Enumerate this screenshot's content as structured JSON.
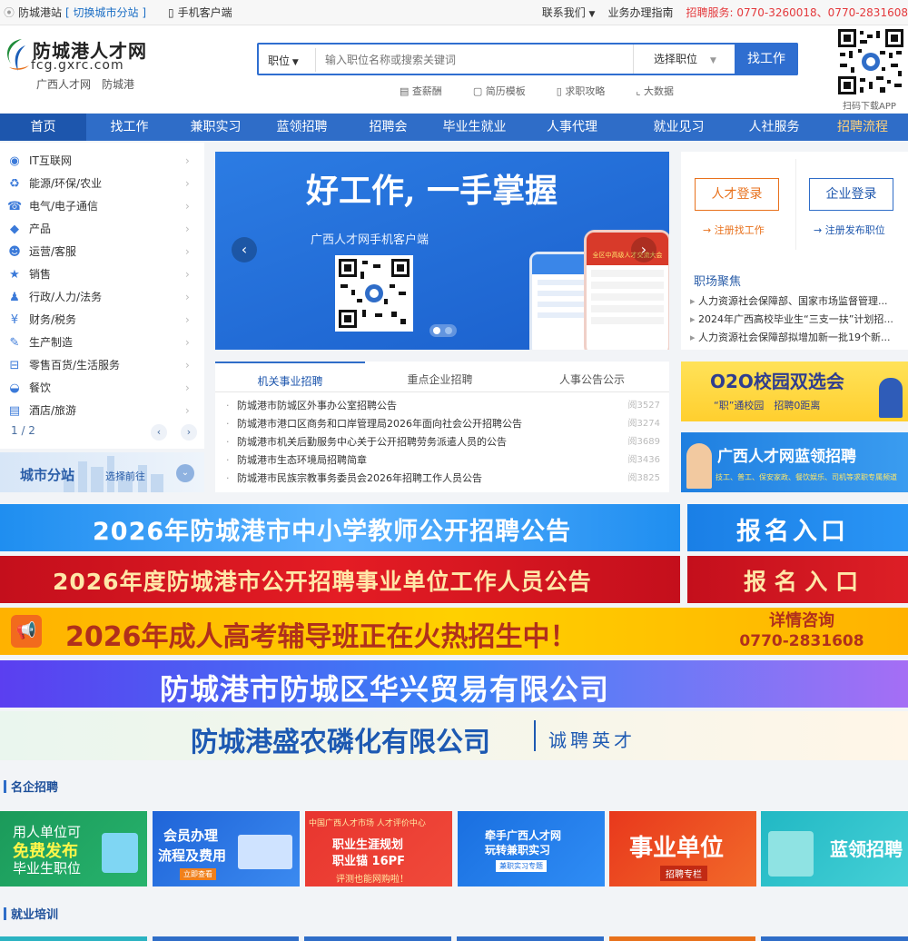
{
  "topbar": {
    "site": "防城港站",
    "switch_city": "[ 切换城市分站 ]",
    "mobile": "手机客户端",
    "contact": "联系我们",
    "guide": "业务办理指南",
    "hotline_label": "招聘服务:",
    "hotline": "0770-3260018、0770-2831608"
  },
  "logo": {
    "name": "防城港人才网",
    "domain": "fcg.gxrc.com",
    "sub": "广西人才网　防城港"
  },
  "search": {
    "type": "职位",
    "placeholder": "输入职位名称或搜索关键词",
    "position_select": "选择职位",
    "button": "找工作"
  },
  "quick_links": [
    "查薪酬",
    "简历模板",
    "求职攻略",
    "大数据"
  ],
  "qr_label": "扫码下载APP",
  "nav": [
    "首页",
    "找工作",
    "兼职实习",
    "蓝领招聘",
    "招聘会",
    "毕业生就业",
    "人事代理",
    "就业见习",
    "人社服务",
    "招聘流程"
  ],
  "categories": [
    {
      "icon": "globe-icon",
      "label": "IT互联网"
    },
    {
      "icon": "recycle-icon",
      "label": "能源/环保/农业"
    },
    {
      "icon": "phone-icon",
      "label": "电气/电子通信"
    },
    {
      "icon": "cube-icon",
      "label": "产品"
    },
    {
      "icon": "people-icon",
      "label": "运营/客服"
    },
    {
      "icon": "star-icon",
      "label": "销售"
    },
    {
      "icon": "user-icon",
      "label": "行政/人力/法务"
    },
    {
      "icon": "money-icon",
      "label": "财务/税务"
    },
    {
      "icon": "wrench-icon",
      "label": "生产制造"
    },
    {
      "icon": "basket-icon",
      "label": "零售百货/生活服务"
    },
    {
      "icon": "bowl-icon",
      "label": "餐饮"
    },
    {
      "icon": "hotel-icon",
      "label": "酒店/旅游"
    }
  ],
  "cat_pager": "1 / 2",
  "city": {
    "title": "城市分站",
    "action": "选择前往"
  },
  "banner": {
    "headline": "好工作, 一手掌握",
    "sub": "广西人才网手机客户端",
    "phone_tag": "全区中高级人才交流大会"
  },
  "login": {
    "talent": "人才登录",
    "company": "企业登录",
    "reg_job": "注册找工作",
    "reg_post": "注册发布职位"
  },
  "focus": {
    "title": "职场聚焦",
    "items": [
      "人力资源社会保障部、国家市场监督管理...",
      "2024年广西高校毕业生“三支一扶”计划招...",
      "人力资源社会保障部拟增加新一批19个新..."
    ]
  },
  "notice": {
    "tabs": [
      "机关事业招聘",
      "重点企业招聘",
      "人事公告公示"
    ],
    "rows": [
      {
        "title": "防城港市防城区外事办公室招聘公告",
        "views": "阅3527"
      },
      {
        "title": "防城港市港口区商务和口岸管理局2026年面向社会公开招聘公告",
        "views": "阅3274"
      },
      {
        "title": "防城港市机关后勤服务中心关于公开招聘劳务派遣人员的公告",
        "views": "阅3689"
      },
      {
        "title": "防城港市生态环境局招聘简章",
        "views": "阅3436"
      },
      {
        "title": "防城港市民族宗教事务委员会2026年招聘工作人员公告",
        "views": "阅3825"
      }
    ]
  },
  "promo": {
    "o2o": "O2O校园双选会",
    "o2o_sub": "“职”通校园　招聘0距离",
    "blue_title": "广西人才网蓝领招聘",
    "blue_sub": "技工、普工、保安家政、餐饮娱乐、司机等求职专属频道"
  },
  "banners": {
    "teacher": "2026年防城港市中小学教师公开招聘公告",
    "enter1": "报名入口",
    "inst": "2026年度防城港市公开招聘事业单位工作人员公告",
    "enter2": "报 名 入 口",
    "adult": "2026年成人高考辅导班正在火热招生中！",
    "consult": "详情咨询",
    "consult_tel": "0770-2831608",
    "huaxing": "防城港市防城区华兴贸易有限公司",
    "shengnong": "防城港盛农磷化有限公司",
    "shengnong_tag": "诚聘英才"
  },
  "sections": {
    "famous": "名企招聘",
    "training": "就业培训"
  },
  "tiles": [
    {
      "l1": "用人单位可",
      "l2": "免费发布",
      "l3": "毕业生职位"
    },
    {
      "l1": "会员办理",
      "l2": "流程及费用",
      "l3": "立即查看"
    },
    {
      "l1": "中国广西人才市场 人才评价中心",
      "l2": "职业生涯规划",
      "l3": "职业锚 16PF",
      "l4": "评测也能网购啦！"
    },
    {
      "l1": "牵手广西人才网",
      "l2": "玩转兼职实习",
      "l3": "兼职实习专题"
    },
    {
      "l1": "事业单位",
      "l2": "招聘专栏"
    },
    {
      "l1": "蓝领招聘"
    }
  ],
  "colors": {
    "primary": "#2f6dc8",
    "orange": "#e8711c",
    "red": "#e4393c"
  }
}
